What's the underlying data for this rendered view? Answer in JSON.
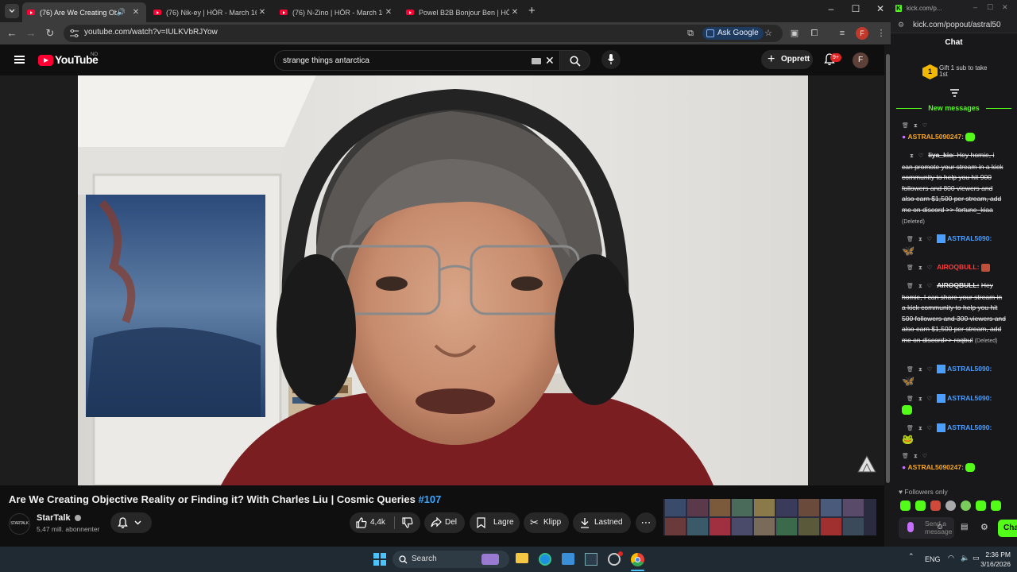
{
  "chrome": {
    "tabs": [
      {
        "label": "(76) Are We Creating Objec",
        "active": true
      },
      {
        "label": "(76) Nik-ey | HÖR - March 16 /",
        "active": false
      },
      {
        "label": "(76) N-Zino | HÖR - March 16 /",
        "active": false
      },
      {
        "label": "Powel B2B Bonjour Ben | HÖR -",
        "active": false
      }
    ],
    "url": "youtube.com/watch?v=IULKVbRJYow",
    "ask_google": "Ask Google",
    "profile_initial": "F"
  },
  "youtube": {
    "logo_text": "YouTube",
    "region": "NO",
    "search_query": "strange things antarctica",
    "create_label": "Opprett",
    "notif_count": "9+",
    "avatar_initial": "F",
    "video": {
      "title": "Are We Creating Objective Reality or Finding it? With Charles Liu | Cosmic Queries",
      "hashtag": "#107"
    },
    "channel": {
      "avatar_text": "STARTALK",
      "name": "StarTalk",
      "subscribers": "5,47 mill. abonnenter"
    },
    "actions": {
      "likes": "4,4k",
      "share": "Del",
      "save": "Lagre",
      "clip": "Klipp",
      "download": "Lastned"
    }
  },
  "kick": {
    "top_url": "kick.com/p...",
    "popout_url": "kick.com/popout/astral50",
    "chat_title": "Chat",
    "gift_rank": "1",
    "gift_text": "Gift 1 sub to take 1st",
    "new_messages": "New messages",
    "messages": [
      {
        "user": "ASTRAL5090247:",
        "text": ""
      },
      {
        "user": "liya_kio",
        "text": "Hey homie, i can promote your stream in a kick community to help you hit 900 followers and 800 viewers and also earn $1,500 per stream, add me on discord >> fortune_kiaa",
        "deleted": "(Deleted)"
      },
      {
        "user": "ASTRAL5090:",
        "text": ""
      },
      {
        "user": "AIROQBULL:",
        "text": ""
      },
      {
        "user": "AIROQBULL:",
        "text": "Hey homie, I can share your stream in a kick community to help you hit 500 followers and 300 viewers and also earn $1,500 per stream, add me on discord>> roqbul",
        "deleted": "(Deleted)"
      },
      {
        "user": "ASTRAL5090:",
        "text": ""
      },
      {
        "user": "ASTRAL5090:",
        "text": ""
      },
      {
        "user": "ASTRAL5090:",
        "text": ""
      },
      {
        "user": "ASTRAL5090247:",
        "text": ""
      }
    ],
    "followers_only": "Followers only",
    "send_placeholder": "Send a message",
    "chat_button": "Cha"
  },
  "taskbar": {
    "search_label": "Search",
    "lang": "ENG",
    "time": "2:36 PM",
    "date": "3/16/2026"
  }
}
